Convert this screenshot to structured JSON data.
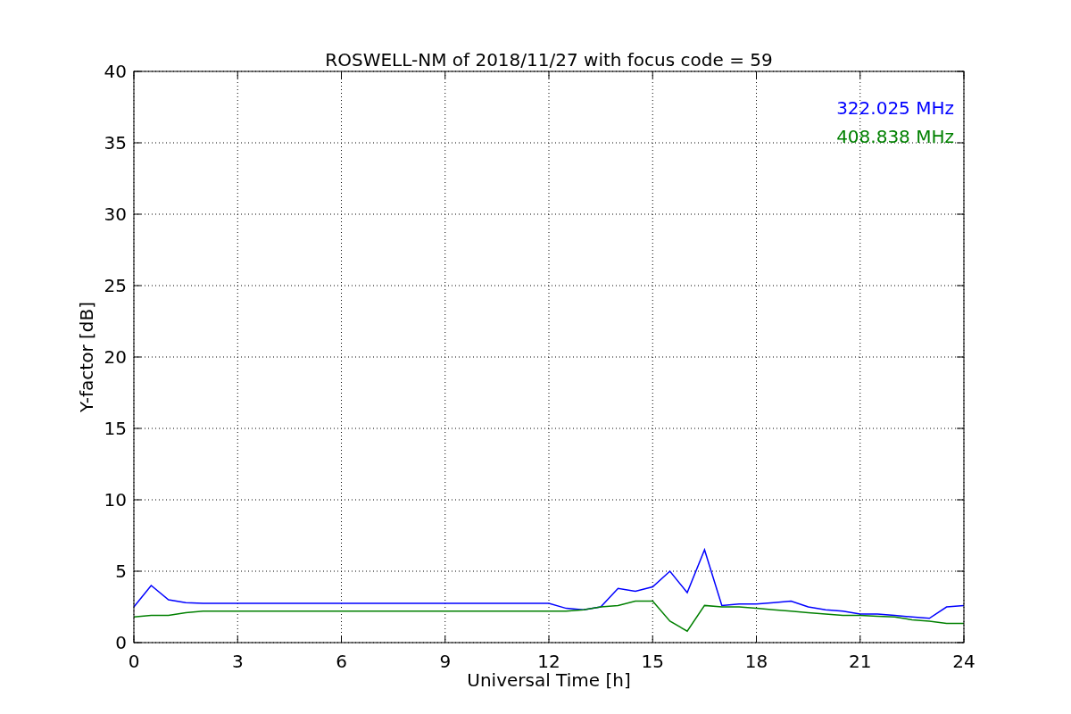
{
  "chart_data": {
    "type": "line",
    "title": "ROSWELL-NM of 2018/11/27 with focus code = 59",
    "xlabel": "Universal Time [h]",
    "ylabel": "Y-factor [dB]",
    "x": [
      0,
      0.5,
      1,
      1.5,
      2,
      3,
      4,
      5,
      6,
      7,
      8,
      9,
      10,
      11,
      12,
      12.5,
      13,
      13.5,
      14,
      14.5,
      15,
      15.5,
      16,
      16.5,
      17,
      17.5,
      18,
      18.5,
      19,
      19.5,
      20,
      20.5,
      21,
      21.5,
      22,
      22.5,
      23,
      23.5,
      24
    ],
    "series": [
      {
        "name": "322.025 MHz",
        "color": "#0000ff",
        "values": [
          2.5,
          4.0,
          3.0,
          2.8,
          2.75,
          2.75,
          2.75,
          2.75,
          2.75,
          2.75,
          2.75,
          2.75,
          2.75,
          2.75,
          2.75,
          2.4,
          2.3,
          2.5,
          3.8,
          3.6,
          3.9,
          5.0,
          3.5,
          6.5,
          2.6,
          2.7,
          2.7,
          2.8,
          2.9,
          2.5,
          2.3,
          2.2,
          2.0,
          2.0,
          1.9,
          1.8,
          1.7,
          2.5,
          2.6
        ]
      },
      {
        "name": "408.838 MHz",
        "color": "#008000",
        "values": [
          1.8,
          1.9,
          1.9,
          2.1,
          2.2,
          2.2,
          2.2,
          2.2,
          2.2,
          2.2,
          2.2,
          2.2,
          2.2,
          2.2,
          2.2,
          2.2,
          2.3,
          2.5,
          2.6,
          2.9,
          2.9,
          1.5,
          0.8,
          2.6,
          2.5,
          2.5,
          2.4,
          2.3,
          2.2,
          2.1,
          2.0,
          1.9,
          1.9,
          1.85,
          1.8,
          1.6,
          1.5,
          1.35,
          1.35
        ]
      }
    ],
    "xlim": [
      0,
      24
    ],
    "ylim": [
      0,
      40
    ],
    "xticks": [
      0,
      3,
      6,
      9,
      12,
      15,
      18,
      21,
      24
    ],
    "yticks": [
      0,
      5,
      10,
      15,
      20,
      25,
      30,
      35,
      40
    ],
    "grid": true
  }
}
